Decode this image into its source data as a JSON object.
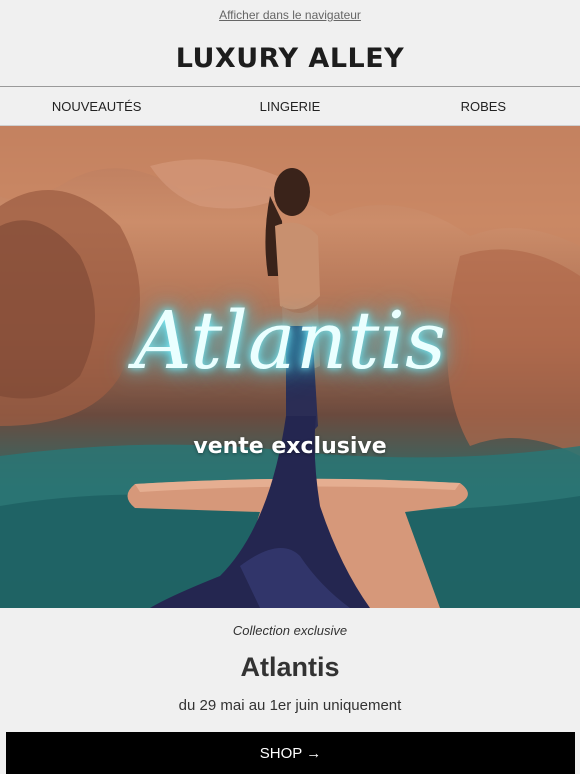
{
  "header": {
    "view_in_browser": "Afficher dans le navigateur",
    "brand": "LUXURY ALLEY"
  },
  "nav": {
    "items": [
      "NOUVEAUTÉS",
      "LINGERIE",
      "ROBES"
    ]
  },
  "hero": {
    "title": "Atlantis",
    "subtitle": "vente exclusive",
    "glow_color": "#7af2ff"
  },
  "content": {
    "eyebrow": "Collection exclusive",
    "headline": "Atlantis",
    "dates": "du 29 mai au 1er juin uniquement"
  },
  "cta": {
    "label": "SHOP →",
    "background": "#000000"
  }
}
